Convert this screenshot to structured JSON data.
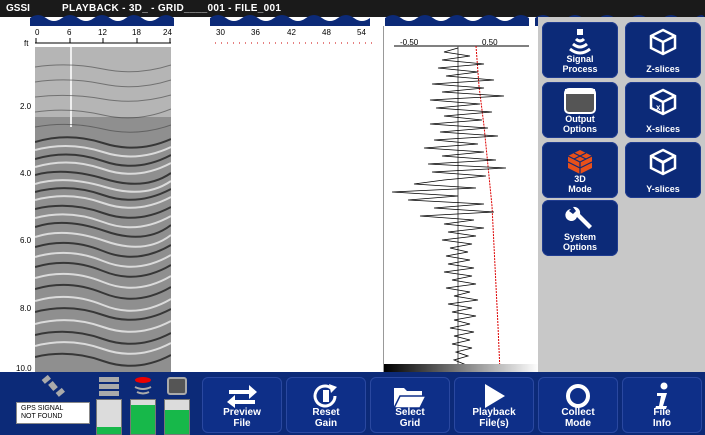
{
  "titlebar": {
    "logo": "GSSI",
    "title": "PLAYBACK - 3D_ - GRID____001 - FILE_001"
  },
  "ruler_top": {
    "ticks": [
      "0",
      "6",
      "12",
      "18",
      "24"
    ],
    "ticks2": [
      "30",
      "36",
      "42",
      "48",
      "54"
    ]
  },
  "ruler_left": {
    "unit": "ft",
    "ticks": [
      "2.0",
      "4.0",
      "6.0",
      "8.0",
      "10.0"
    ]
  },
  "trace": {
    "left_label": "-0.50",
    "right_label": "0.50"
  },
  "side_buttons": [
    {
      "label": "Signal\nProcess",
      "icon": "signal-process-icon"
    },
    {
      "label": "Z-slices",
      "icon": "z-slices-icon"
    },
    {
      "label": "Output\nOptions",
      "icon": "output-options-icon"
    },
    {
      "label": "X-slices",
      "icon": "x-slices-icon"
    },
    {
      "label": "3D\nMode",
      "icon": "3d-mode-icon"
    },
    {
      "label": "Y-slices",
      "icon": "y-slices-icon"
    },
    {
      "label": "System\nOptions",
      "icon": "wrench-icon"
    }
  ],
  "status": {
    "gps_text": "GPS SIGNAL\nNOT FOUND",
    "meters": [
      {
        "level": 0.22,
        "color": "#17b84a"
      },
      {
        "level": 0.85,
        "color": "#17b84a"
      },
      {
        "level": 0.7,
        "color": "#17b84a"
      }
    ]
  },
  "bottom_buttons": [
    {
      "label": "Preview\nFile",
      "icon": "swap-arrows-icon"
    },
    {
      "label": "Reset\nGain",
      "icon": "reset-gain-icon"
    },
    {
      "label": "Select\nGrid",
      "icon": "folder-open-icon"
    },
    {
      "label": "Playback\nFile(s)",
      "icon": "play-icon"
    },
    {
      "label": "Collect\nMode",
      "icon": "circle-icon"
    },
    {
      "label": "File\nInfo",
      "icon": "info-icon"
    }
  ]
}
